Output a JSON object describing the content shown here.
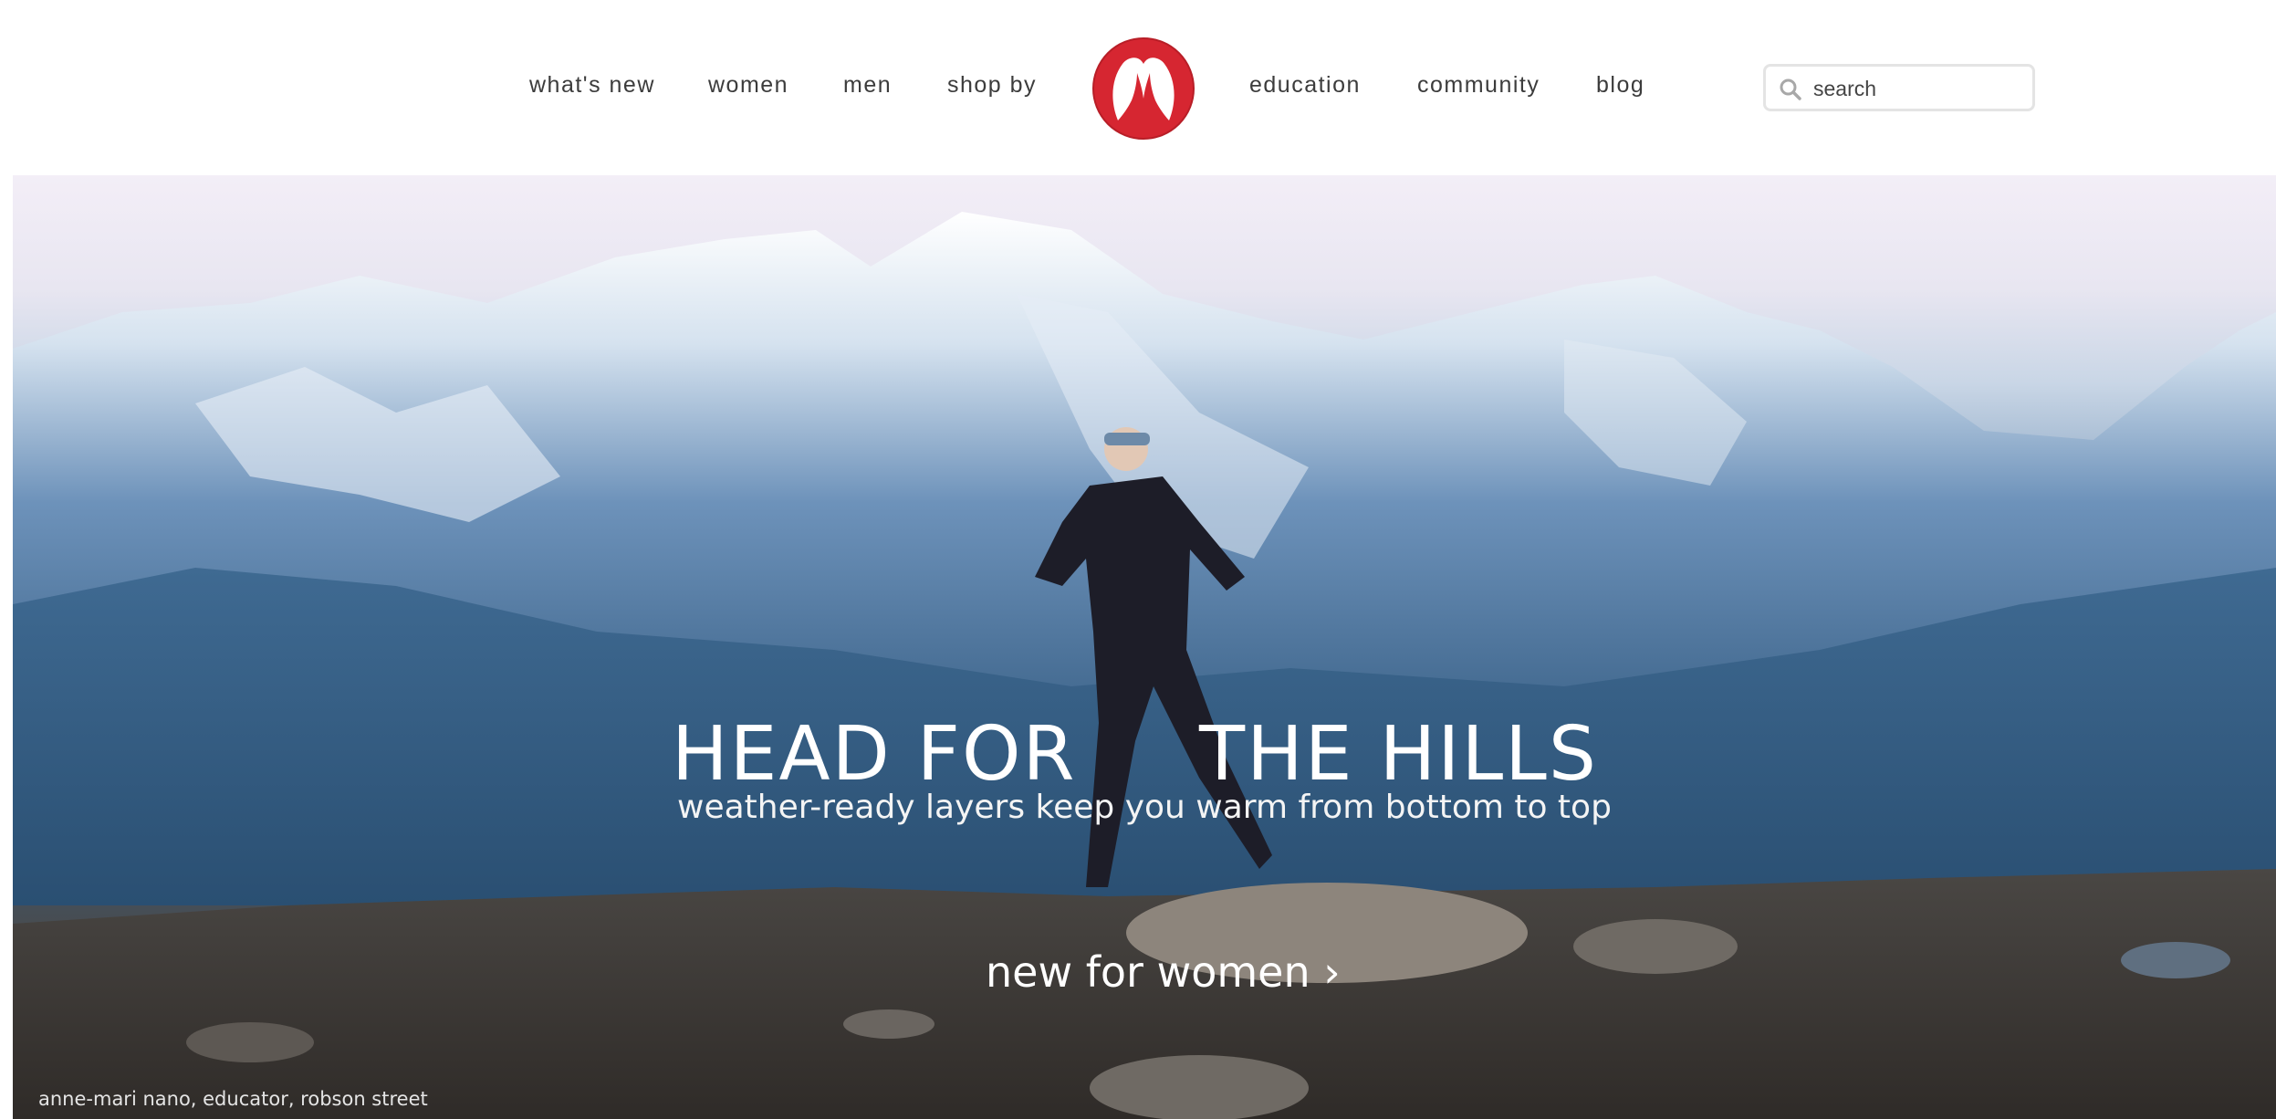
{
  "nav": {
    "left": [
      "what's new",
      "women",
      "men",
      "shop by"
    ],
    "right": [
      "education",
      "community",
      "blog"
    ]
  },
  "search": {
    "placeholder": "search"
  },
  "hero": {
    "headline_left": "HEAD FOR",
    "headline_right": "THE HILLS",
    "subline": "weather-ready layers keep you warm from bottom to top",
    "cta": "new for women ›",
    "caption": "anne-mari nano, educator, robson street"
  },
  "colors": {
    "brand_red": "#d62631",
    "nav_text": "#3c3c3c"
  },
  "icons": [
    "lululemon-logo",
    "search-icon"
  ]
}
